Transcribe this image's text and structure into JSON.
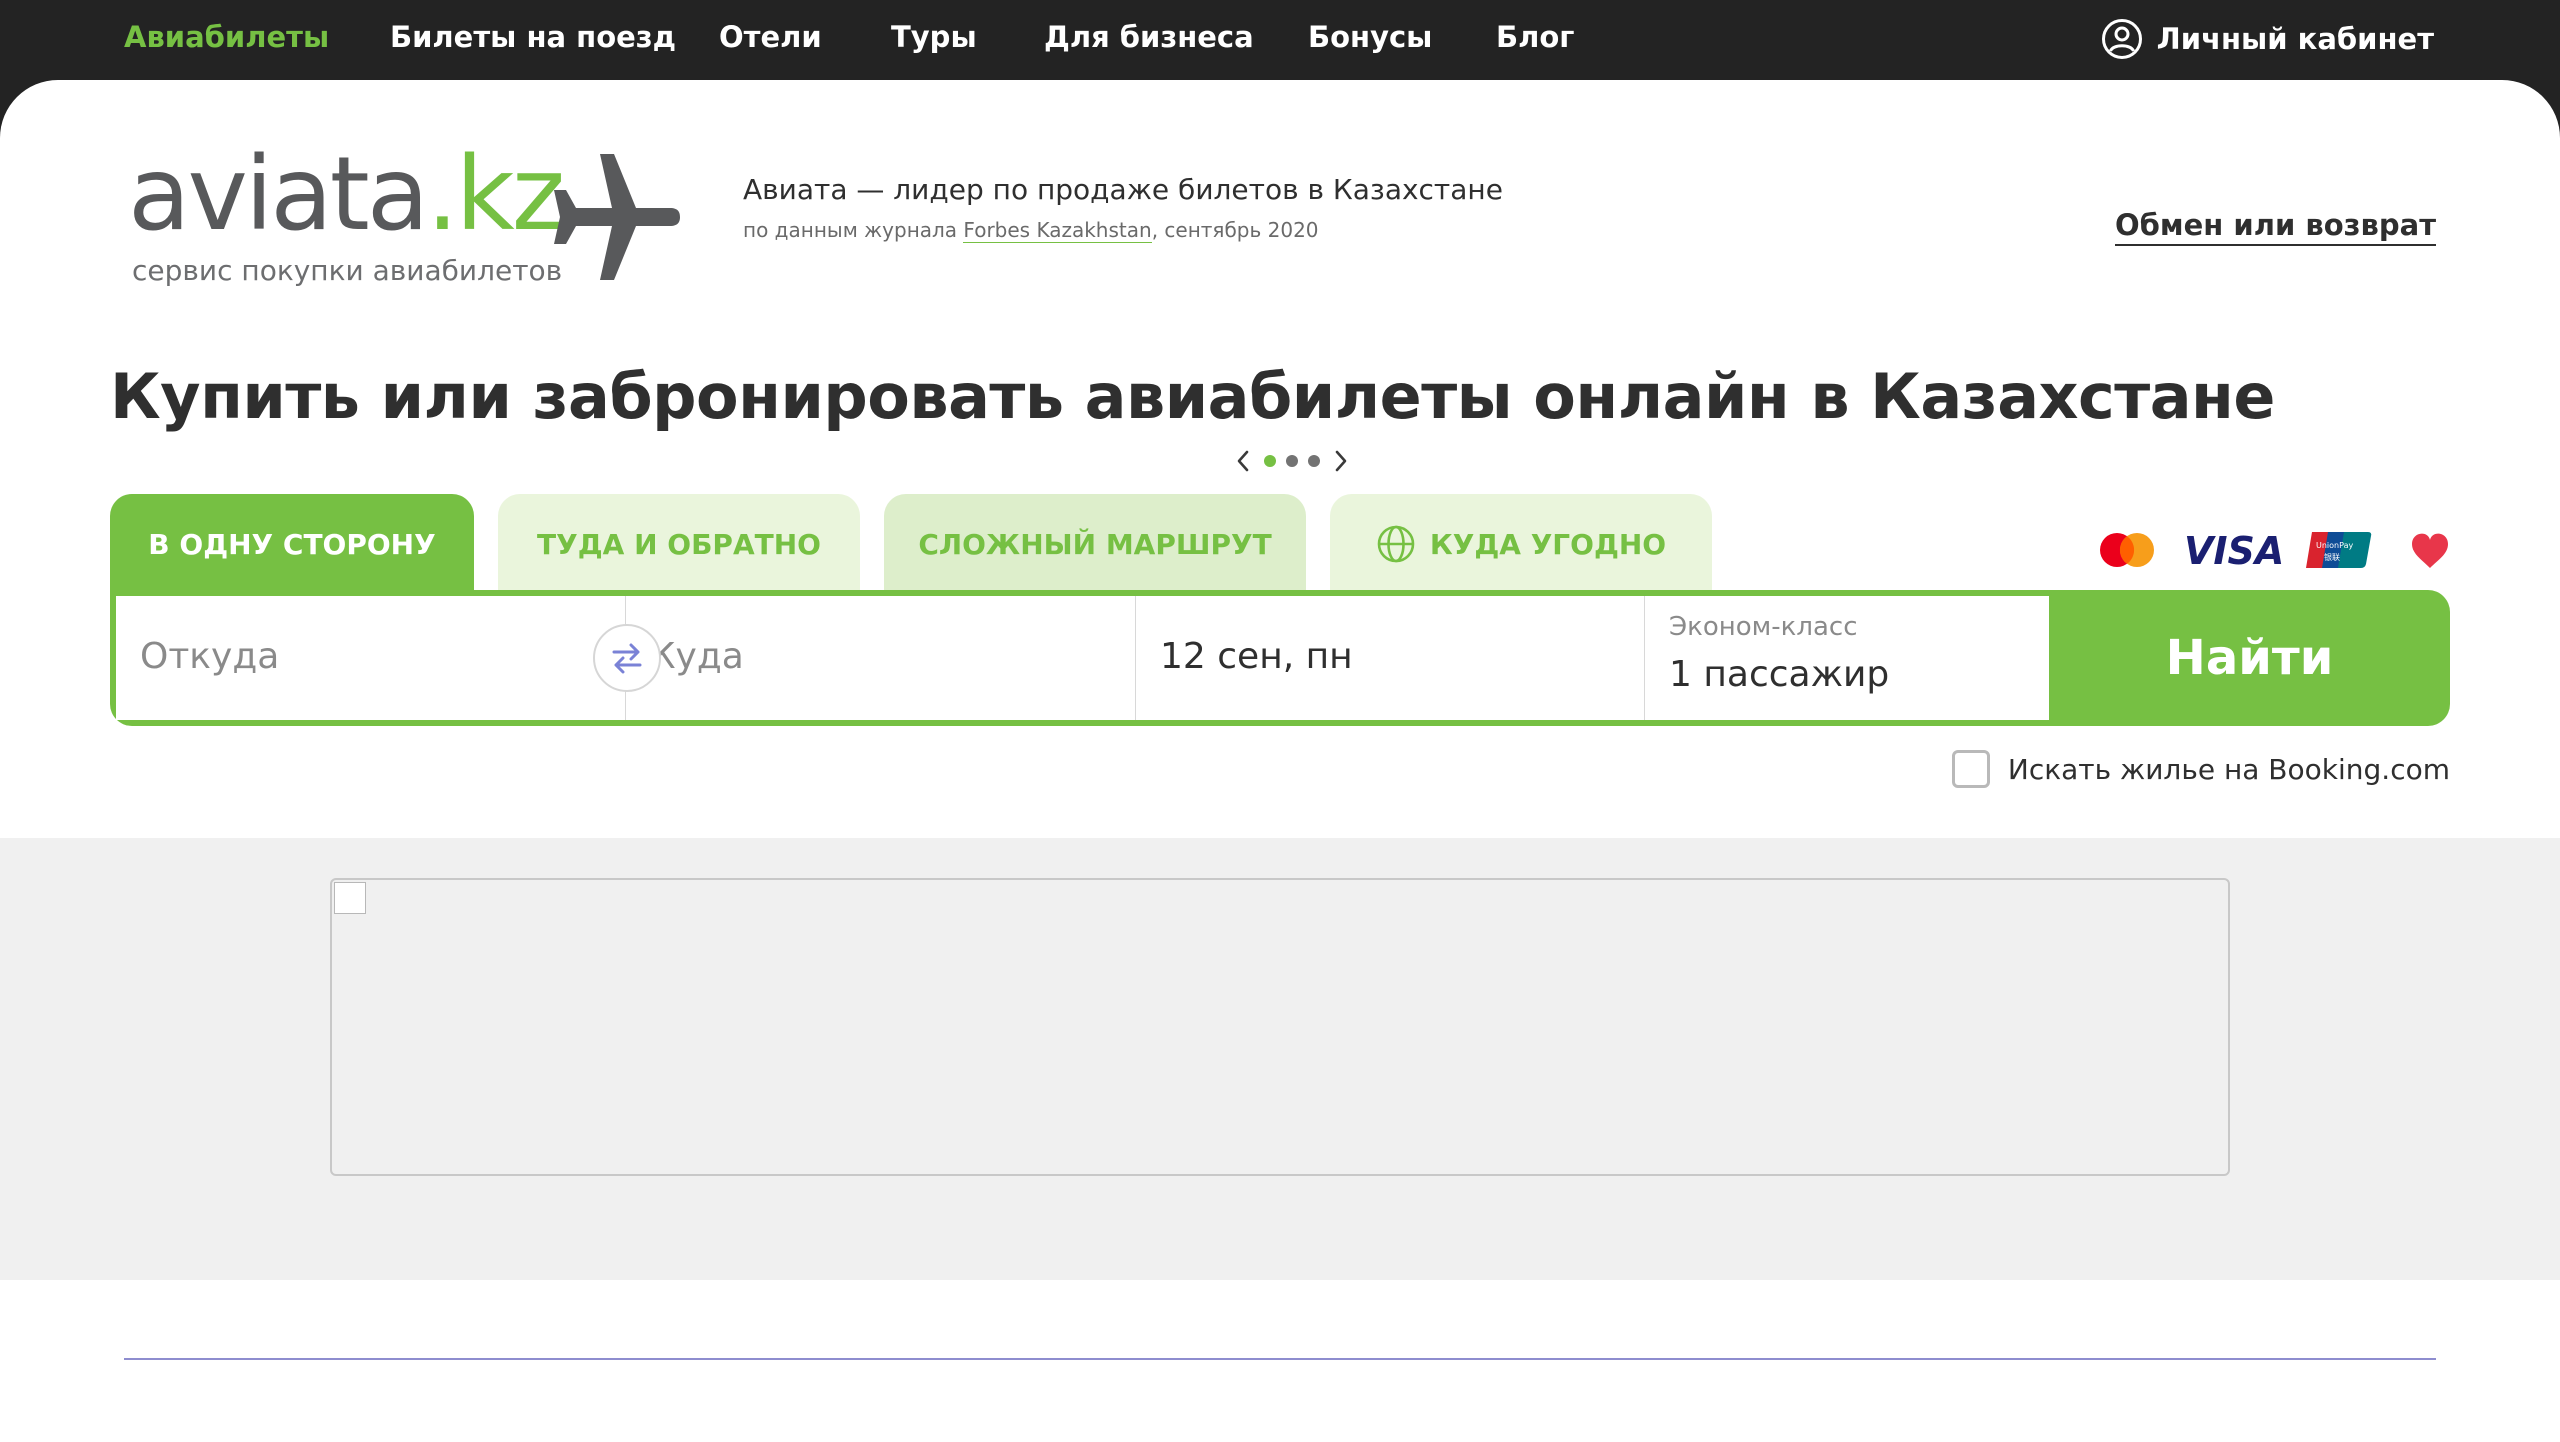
{
  "nav": {
    "items": [
      "Авиабилеты",
      "Билеты на поезд",
      "Отели",
      "Туры",
      "Для бизнеса",
      "Бонусы",
      "Блог"
    ],
    "active_index": 0,
    "cabinet_label": "Личный кабинет",
    "cabinet_icon": "user-circle-icon"
  },
  "logo": {
    "brand_main": "aviata",
    "brand_tld": ".kz",
    "subtitle": "сервис покупки авиабилетов",
    "icon": "airplane-icon"
  },
  "leader": {
    "title": "Авиата — лидер по продаже билетов в Казахстане",
    "note_prefix": "по данным журнала ",
    "note_link": "Forbes Kazakhstan",
    "note_suffix": ", сентябрь 2020"
  },
  "exchange_link": "Обмен или возврат",
  "page_title": "Купить или забронировать авиабилеты онлайн в Казахстане",
  "tabs": [
    {
      "label": "В ОДНУ СТОРОНУ",
      "active": true
    },
    {
      "label": "ТУДА И ОБРАТНО",
      "active": false
    },
    {
      "label": "СЛОЖНЫЙ МАРШРУТ",
      "active": false
    },
    {
      "label": "КУДА УГОДНО",
      "active": false,
      "icon": "globe-icon"
    }
  ],
  "payment_icons": [
    "mastercard-icon",
    "visa-icon",
    "unionpay-icon",
    "heart-icon"
  ],
  "search": {
    "from_placeholder": "Откуда",
    "to_placeholder": "Куда",
    "date": "12 сен, пн",
    "cabin_class": "Эконом-класс",
    "passengers": "1 пассажир",
    "submit_label": "Найти"
  },
  "booking_checkbox": {
    "label": "Искать жилье на Booking.com",
    "checked": false
  },
  "carousel": {
    "slides": 3,
    "active": 0
  },
  "colors": {
    "accent": "#76c043",
    "nav_bg": "#232323",
    "text": "#2f2f2f",
    "tab_light": "#eaf5dc"
  }
}
